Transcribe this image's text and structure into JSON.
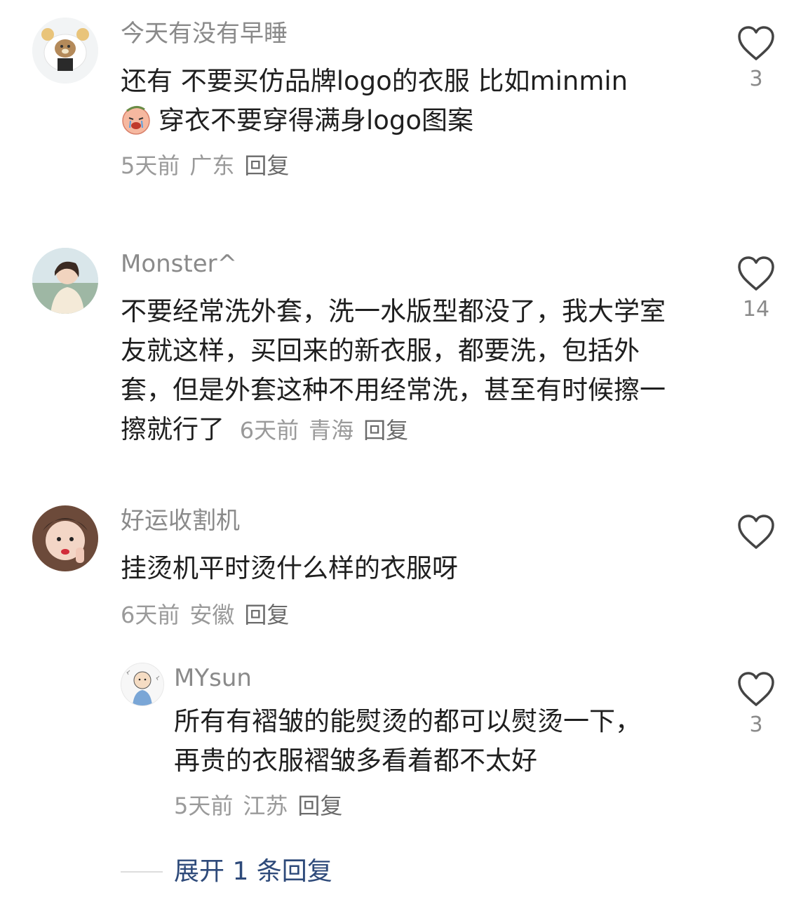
{
  "comments": [
    {
      "username": "今天有没有早睡",
      "text_line1": "还有 不要买仿品牌logo的衣服 比如minmin",
      "text_line2": "穿衣不要穿得满身logo图案",
      "inline_emoji": "crying-face-emoji",
      "time": "5天前",
      "location": "广东",
      "reply_label": "回复",
      "likes": "3",
      "avatar_icon": "bear-avatar"
    },
    {
      "username": "Monster^",
      "text": "不要经常洗外套，洗一水版型都没了，我大学室友就这样，买回来的新衣服，都要洗，包括外套，但是外套这种不用经常洗，甚至有时候擦一擦就行了",
      "time": "6天前",
      "location": "青海",
      "reply_label": "回复",
      "likes": "14",
      "avatar_icon": "person-photo-avatar"
    },
    {
      "username": "好运收割机",
      "text": "挂烫机平时烫什么样的衣服呀",
      "time": "6天前",
      "location": "安徽",
      "reply_label": "回复",
      "likes": "",
      "avatar_icon": "person-photo-avatar"
    }
  ],
  "reply": {
    "username": "MYsun",
    "text": "所有有褶皱的能熨烫的都可以熨烫一下，再贵的衣服褶皱多看着都不太好",
    "time": "5天前",
    "location": "江苏",
    "reply_label": "回复",
    "likes": "3",
    "avatar_icon": "cartoon-avatar"
  },
  "expand_replies_label": "展开 1 条回复",
  "colors": {
    "username": "#8a8a8a",
    "text": "#1f1f1f",
    "meta": "#9a9a9a",
    "expand": "#2e4a7a",
    "heart_outline": "#444444"
  }
}
